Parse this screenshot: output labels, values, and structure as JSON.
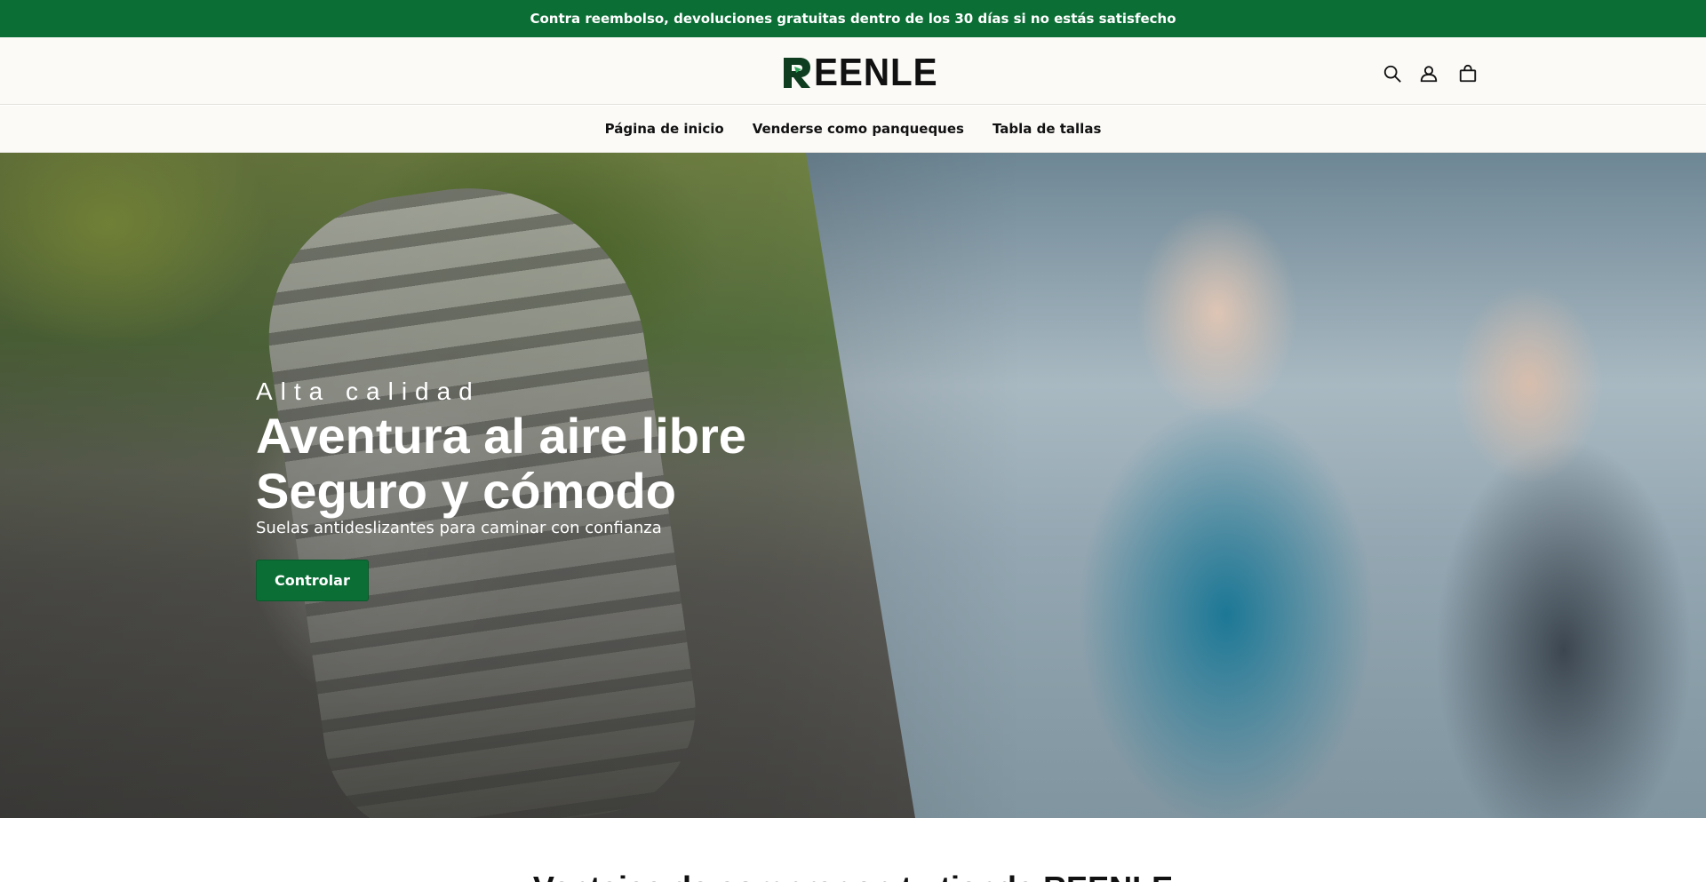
{
  "announcement": {
    "text": "Contra reembolso, devoluciones gratuitas dentro de los 30 días si no estás satisfecho"
  },
  "header": {
    "logo_text": "EENLE",
    "logo_alt": "REENLE",
    "icons": [
      "search-icon",
      "account-icon",
      "cart-icon"
    ]
  },
  "nav": {
    "items": [
      {
        "label": "Página de inicio"
      },
      {
        "label": "Venderse como panqueques"
      },
      {
        "label": "Tabla de tallas"
      }
    ]
  },
  "hero": {
    "eyebrow": "Alta calidad",
    "title_line1": "Aventura al aire libre",
    "title_line2": "Seguro y cómodo",
    "subtitle": "Suelas antideslizantes para caminar con confianza",
    "button_label": "Controlar"
  },
  "section": {
    "heading": "Ventajas de comprar en tu tienda REENLE"
  },
  "colors": {
    "brand_green": "#0b6e35",
    "header_bg": "#fbfaf7"
  }
}
